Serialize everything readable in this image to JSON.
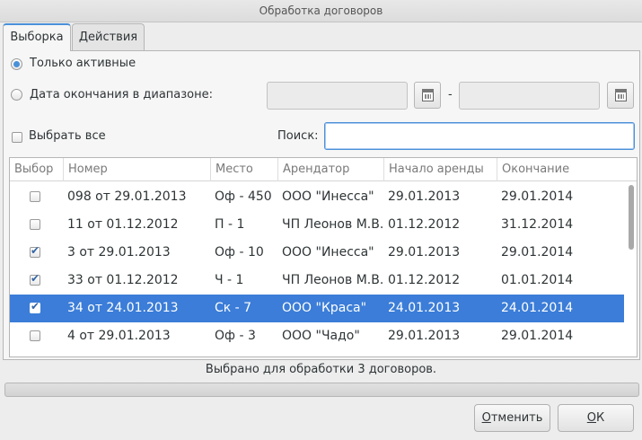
{
  "window": {
    "title": "Обработка договоров"
  },
  "tabs": [
    {
      "label": "Выборка",
      "active": true
    },
    {
      "label": "Действия",
      "active": false
    }
  ],
  "filters": {
    "only_active_label": "Только активные",
    "date_range_label": "Дата окончания в диапазоне:",
    "date_from_value": "",
    "date_to_value": "",
    "range_separator": "-",
    "select_all_label": "Выбрать все",
    "search_label": "Поиск:",
    "search_value": ""
  },
  "table": {
    "columns": [
      "Выбор",
      "Номер",
      "Место",
      "Арендатор",
      "Начало аренды",
      "Окончание"
    ],
    "rows": [
      {
        "checked": false,
        "number": "098 от 29.01.2013",
        "place": "Оф - 450",
        "tenant": "ООО \"Инесса\"",
        "start": "29.01.2013",
        "end": "29.01.2014",
        "selected": false
      },
      {
        "checked": false,
        "number": "11 от 01.12.2012",
        "place": "П - 1",
        "tenant": "ЧП Леонов М.В.",
        "start": "01.12.2012",
        "end": "31.12.2014",
        "selected": false
      },
      {
        "checked": true,
        "number": "3 от 29.01.2013",
        "place": "Оф - 10",
        "tenant": "ООО \"Инесса\"",
        "start": "29.01.2013",
        "end": "29.01.2014",
        "selected": false
      },
      {
        "checked": true,
        "number": "33 от 01.12.2012",
        "place": "Ч - 1",
        "tenant": "ЧП Леонов М.В.",
        "start": "01.12.2012",
        "end": "01.01.2014",
        "selected": false
      },
      {
        "checked": true,
        "number": "34 от 24.01.2013",
        "place": "Ск - 7",
        "tenant": "ООО \"Краса\"",
        "start": "24.01.2013",
        "end": "24.01.2014",
        "selected": true
      },
      {
        "checked": false,
        "number": "4 от 29.01.2013",
        "place": "Оф - 3",
        "tenant": "ООО \"Чадо\"",
        "start": "29.01.2013",
        "end": "29.01.2014",
        "selected": false
      }
    ]
  },
  "status": {
    "text": "Выбрано для обработки 3 договоров.",
    "progress": 0
  },
  "buttons": {
    "cancel_mnemonic": "О",
    "cancel_rest": "тменить",
    "ok_mnemonic": "О",
    "ok_rest": "К"
  },
  "colors": {
    "accent": "#4a90d9",
    "selection": "#3b7dd8"
  },
  "icons": {
    "calendar": "calendar-icon",
    "check": "checkmark-icon"
  }
}
